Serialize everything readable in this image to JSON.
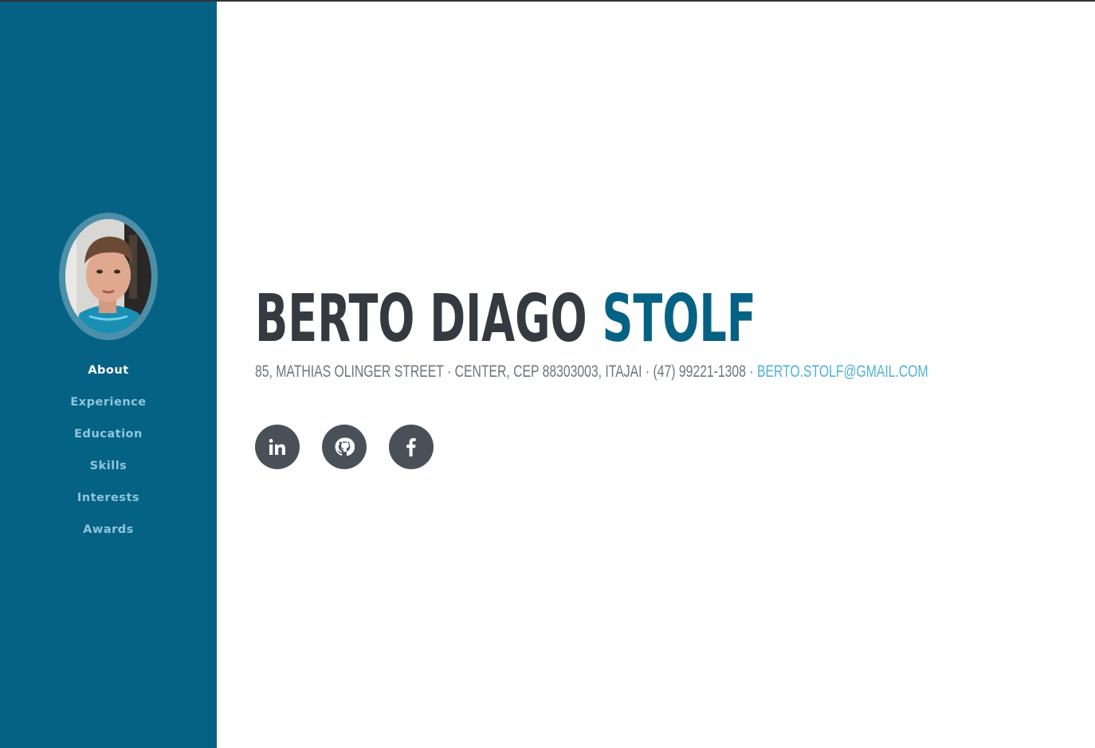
{
  "sidebar": {
    "avatar_alt": "profile photo",
    "nav": [
      {
        "label": "About",
        "active": true
      },
      {
        "label": "Experience"
      },
      {
        "label": "Education"
      },
      {
        "label": "Skills"
      },
      {
        "label": "Interests"
      },
      {
        "label": "Awards"
      }
    ]
  },
  "about": {
    "first_name": "BERTO DIAGO",
    "last_name": "STOLF",
    "address": "85, Mathias Olinger Street · Center, CEP 88303003, Itajai · (47) 99221-1308 · ",
    "email": "BERTO.STOLF@GMAIL.COM"
  },
  "social": [
    {
      "name": "linkedin",
      "icon": "linkedin-icon"
    },
    {
      "name": "github",
      "icon": "github-icon"
    },
    {
      "name": "facebook",
      "icon": "facebook-icon"
    }
  ],
  "colors": {
    "sidebar": "#066285",
    "name_dark": "#343a40",
    "accent": "#066285",
    "email": "#4fb1d8",
    "nav_inactive": "#8ec6da",
    "social_bg": "#495057"
  }
}
